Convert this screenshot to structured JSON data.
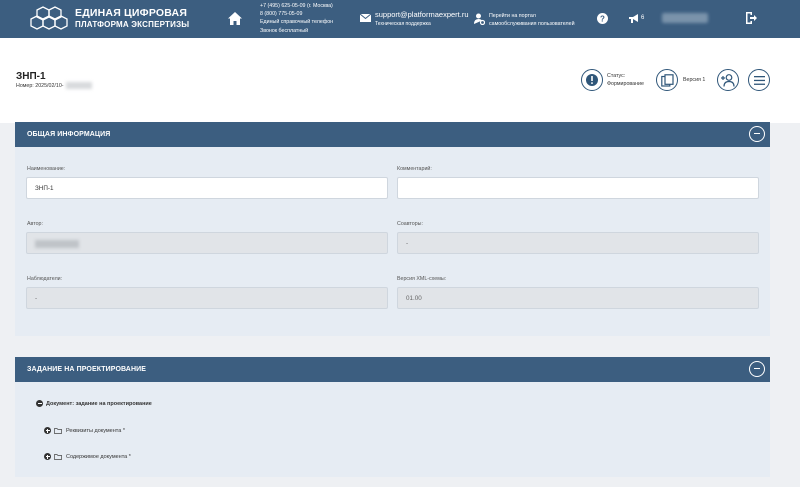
{
  "header": {
    "brand_line1": "ЕДИНАЯ ЦИФРОВАЯ",
    "brand_line2": "ПЛАТФОРМА ЭКСПЕРТИЗЫ",
    "phone_msk": "+7 (495) 625-05-09 (г. Москва)",
    "phone_free": "8 (800) 775-05-09",
    "phone_desc1": "Единый справочный телефон",
    "phone_desc2": "Звонок бесплатный",
    "support_email": "support@platformaexpert.ru",
    "support_desc": "Техническая поддержка",
    "portal_line1": "Перейти на портал",
    "portal_line2": "самообслуживания пользователей",
    "notify_count": "6"
  },
  "doc": {
    "title": "ЗНП-1",
    "number_label": "Номер:",
    "number_value": "2025/02/10-",
    "status_label": "Статус:",
    "status_value": "Формирование",
    "version_label": "Версия 1"
  },
  "general": {
    "title": "ОБЩАЯ ИНФОРМАЦИЯ",
    "name_label": "Наименование:",
    "name_value": "ЗНП-1",
    "comment_label": "Комментарий:",
    "comment_value": "",
    "author_label": "Автор:",
    "coauthors_label": "Соавторы:",
    "coauthors_value": "-",
    "observers_label": "Наблюдатели:",
    "observers_value": "-",
    "xml_label": "Версия XML-схемы:",
    "xml_value": "01.00"
  },
  "task": {
    "title": "ЗАДАНИЕ НА ПРОЕКТИРОВАНИЕ",
    "doc_node": "Документ: задание на проектирование",
    "node1": "Реквизиты документа *",
    "node2": "Содержимое документа *"
  }
}
